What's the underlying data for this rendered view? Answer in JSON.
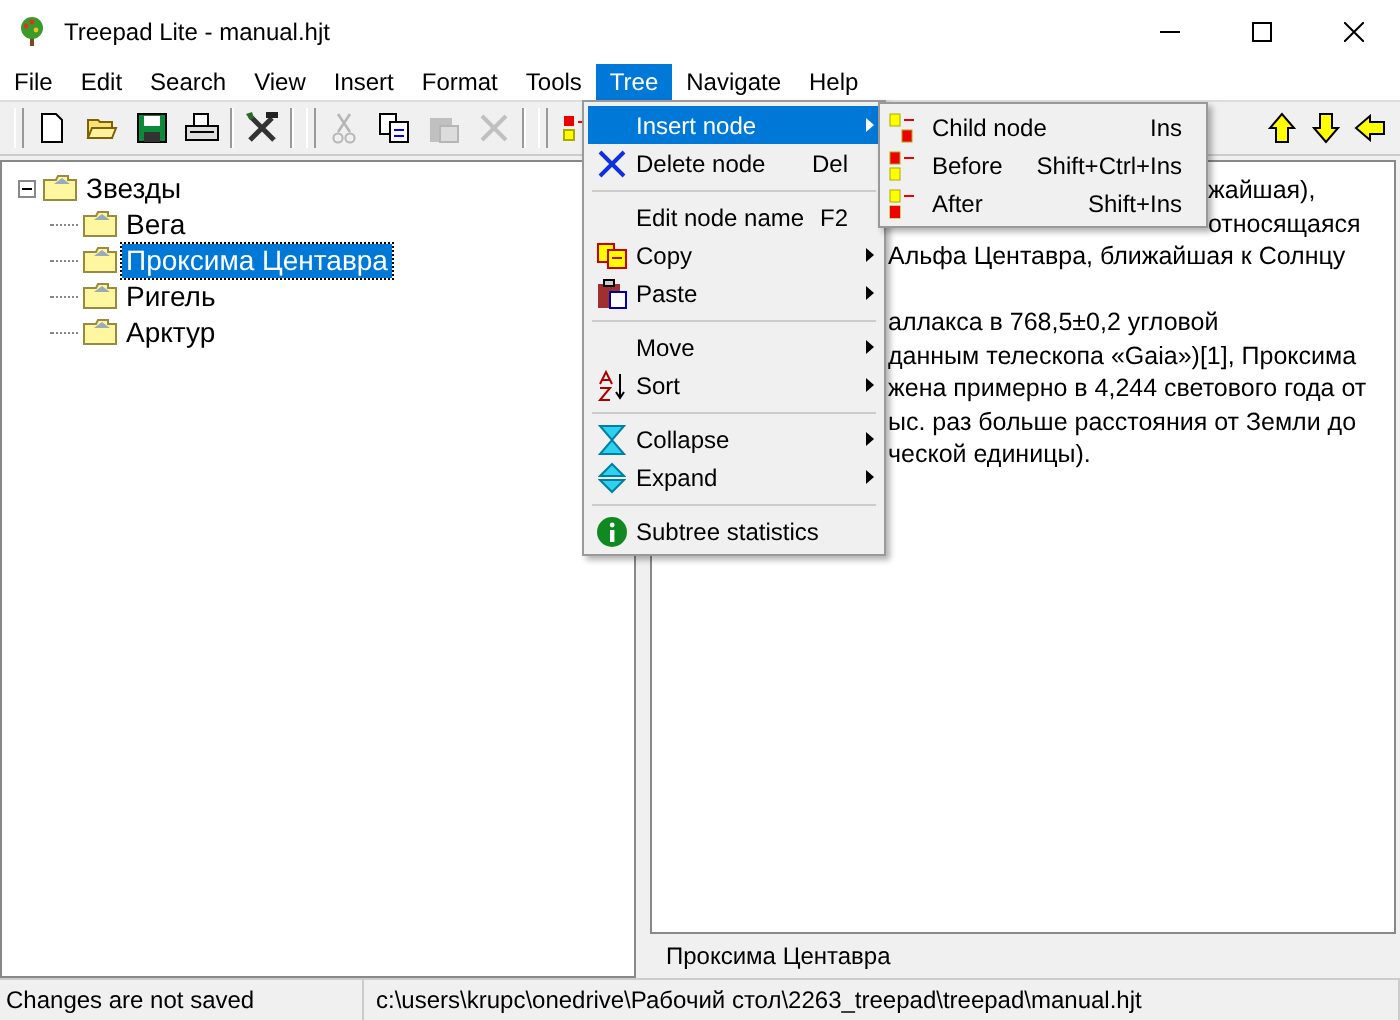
{
  "window": {
    "title": "Treepad Lite - manual.hjt"
  },
  "menu_bar": [
    {
      "label": "File",
      "selected": false
    },
    {
      "label": "Edit",
      "selected": false
    },
    {
      "label": "Search",
      "selected": false
    },
    {
      "label": "View",
      "selected": false
    },
    {
      "label": "Insert",
      "selected": false
    },
    {
      "label": "Format",
      "selected": false
    },
    {
      "label": "Tools",
      "selected": false
    },
    {
      "label": "Tree",
      "selected": true
    },
    {
      "label": "Navigate",
      "selected": false
    },
    {
      "label": "Help",
      "selected": false
    }
  ],
  "toolbar": [
    {
      "disabled": false
    },
    {
      "disabled": false
    },
    {
      "disabled": false
    },
    {
      "disabled": false
    },
    {
      "disabled": false
    },
    {
      "disabled": true
    },
    {
      "disabled": false
    },
    {
      "disabled": true
    },
    {
      "disabled": true
    },
    {
      "disabled": false
    }
  ],
  "tree": [
    {
      "label": "Звезды",
      "selected": false,
      "expanded": true,
      "children": [
        {
          "label": "Вега",
          "selected": false
        },
        {
          "label": "Проксима Центавра",
          "selected": true
        },
        {
          "label": "Ригель",
          "selected": false
        },
        {
          "label": "Арктур",
          "selected": false
        }
      ]
    }
  ],
  "editor_paragraphs": [
    {
      "lines": [
        "жайшая),",
        "относящаяся",
        "Альфа Центавра, ближайшая к Солнцу"
      ]
    },
    {
      "lines": [
        "аллакса в 768,5±0,2 угловой",
        "данным телескопа «Gaia»)[1], Проксима",
        "жена примерно в 4,244 светового года от",
        "ыс. раз больше расстояния от Земли до",
        "ческой единицы)."
      ]
    }
  ],
  "node_title": "Проксима Центавра",
  "status_bar": [
    "Changes are not saved",
    "c:\\users\\krupc\\onedrive\\Рабочий стол\\2263_treepad\\treepad\\manual.hjt"
  ],
  "tree_menu": [
    {
      "kind": "item",
      "label": "Insert node",
      "submenu": true,
      "selected": true
    },
    {
      "kind": "item",
      "label": "Delete node",
      "shortcut": "Del",
      "submenu": false,
      "selected": false
    },
    {
      "kind": "separator"
    },
    {
      "kind": "item",
      "label": "Edit node name",
      "shortcut": "F2",
      "submenu": false,
      "selected": false
    },
    {
      "kind": "item",
      "label": "Copy",
      "submenu": true,
      "selected": false
    },
    {
      "kind": "item",
      "label": "Paste",
      "submenu": true,
      "selected": false
    },
    {
      "kind": "separator"
    },
    {
      "kind": "item",
      "label": "Move",
      "submenu": true,
      "selected": false
    },
    {
      "kind": "item",
      "label": "Sort",
      "submenu": true,
      "selected": false
    },
    {
      "kind": "separator"
    },
    {
      "kind": "item",
      "label": "Collapse",
      "submenu": true,
      "selected": false
    },
    {
      "kind": "item",
      "label": "Expand",
      "submenu": true,
      "selected": false
    },
    {
      "kind": "separator"
    },
    {
      "kind": "item",
      "label": "Subtree statistics",
      "submenu": false,
      "selected": false
    }
  ],
  "insert_submenu": [
    {
      "label": "Child node",
      "shortcut": "Ins",
      "selected": false
    },
    {
      "label": "Before",
      "shortcut": "Shift+Ctrl+Ins",
      "selected": false
    },
    {
      "label": "After",
      "shortcut": "Shift+Ins",
      "selected": false
    }
  ]
}
